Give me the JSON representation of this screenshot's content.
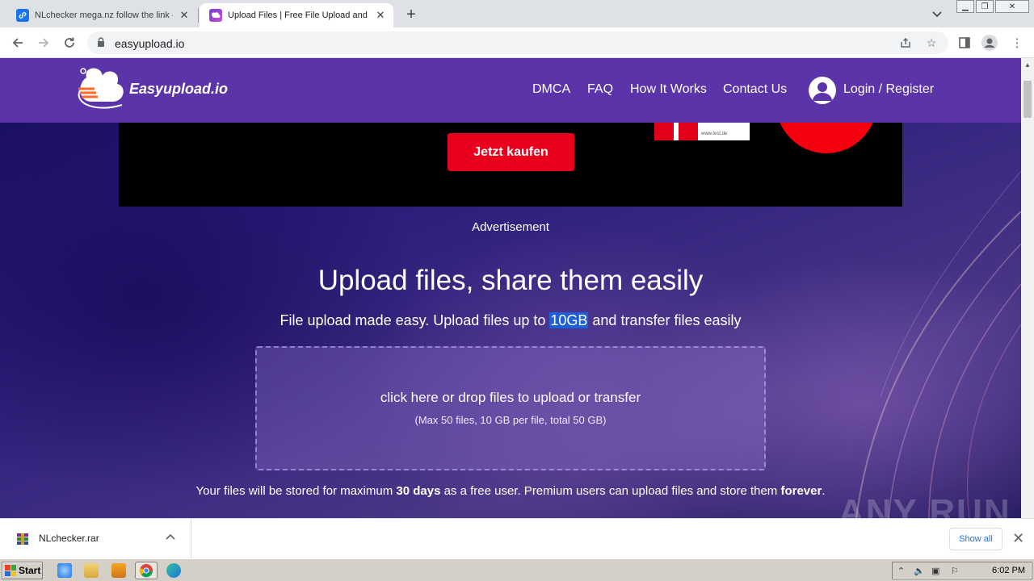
{
  "browser": {
    "tabs": [
      {
        "title": "NLchecker mega.nz follow the link —",
        "active": false
      },
      {
        "title": "Upload Files | Free File Upload and Tr",
        "active": true
      }
    ],
    "url": "easyupload.io"
  },
  "site": {
    "brand": "Easyupload.io",
    "nav": [
      "DMCA",
      "FAQ",
      "How It Works",
      "Contact Us"
    ],
    "login": "Login / Register"
  },
  "ad": {
    "button": "Jetzt kaufen",
    "badge_text": "www.test.de",
    "label": "Advertisement"
  },
  "hero": {
    "title": "Upload files, share them easily",
    "subtitle_pre": "File upload made easy. Upload files up to ",
    "subtitle_highlight": "10GB",
    "subtitle_post": " and transfer files easily"
  },
  "dropzone": {
    "main": "click here or drop files to upload or transfer",
    "sub": "(Max 50 files, 10 GB per file, total 50 GB)"
  },
  "storage": {
    "pre": "Your files will be stored for maximum ",
    "days": "30 days",
    "mid": " as a free user. Premium users can upload files and store them ",
    "forever": "forever",
    "post": "."
  },
  "watermark": "ANY RUN",
  "downloads": {
    "file": "NLchecker.rar",
    "show_all": "Show all"
  },
  "taskbar": {
    "start": "Start",
    "clock": "6:02 PM"
  },
  "colors": {
    "nav_bg": "#5a34a8",
    "ad_red": "#e8001c",
    "highlight": "#1e5fd8"
  }
}
